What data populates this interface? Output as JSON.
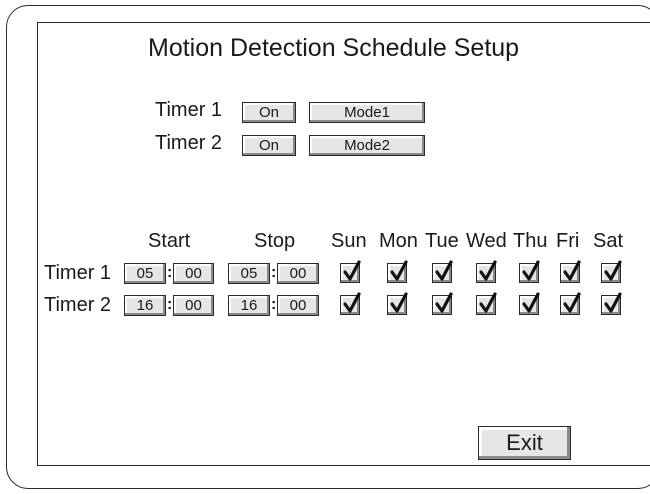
{
  "title": "Motion Detection Schedule Setup",
  "top_timers": [
    {
      "label": "Timer 1",
      "state": "On",
      "mode": "Mode1"
    },
    {
      "label": "Timer 2",
      "state": "On",
      "mode": "Mode2"
    }
  ],
  "headers": {
    "start": "Start",
    "stop": "Stop",
    "days": [
      "Sun",
      "Mon",
      "Tue",
      "Wed",
      "Thu",
      "Fri",
      "Sat"
    ]
  },
  "schedule": [
    {
      "label": "Timer 1",
      "start_hour": "05",
      "start_min": "00",
      "stop_hour": "05",
      "stop_min": "00",
      "days": [
        true,
        true,
        true,
        true,
        true,
        true,
        true
      ]
    },
    {
      "label": "Timer 2",
      "start_hour": "16",
      "start_min": "00",
      "stop_hour": "16",
      "stop_min": "00",
      "days": [
        true,
        true,
        true,
        true,
        true,
        true,
        true
      ]
    }
  ],
  "colon": ":",
  "exit_label": "Exit"
}
